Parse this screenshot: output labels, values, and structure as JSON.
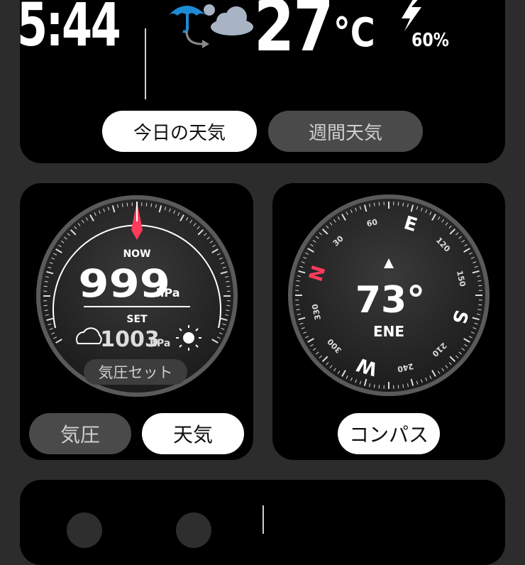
{
  "top": {
    "time": "5:44",
    "temperature": "27",
    "temp_unit": "°C",
    "humidity": "60%",
    "tabs": [
      {
        "label": "今日の天気",
        "active": true
      },
      {
        "label": "週間天気",
        "active": false
      }
    ]
  },
  "barometer": {
    "now_label": "NOW",
    "now_value": "999",
    "now_unit": "hPa",
    "set_label": "SET",
    "set_value": "1003",
    "set_unit": "hPa",
    "set_button": "気圧セット",
    "tabs": [
      {
        "label": "気圧",
        "active": false
      },
      {
        "label": "天気",
        "active": true
      }
    ]
  },
  "compass": {
    "heading": "73°",
    "direction": "ENE",
    "cardinals": {
      "N": "N",
      "E": "E",
      "S": "S",
      "W": "W"
    },
    "degree_marks": [
      "30",
      "60",
      "120",
      "150",
      "210",
      "240",
      "300",
      "330"
    ],
    "button": "コンパス"
  },
  "colors": {
    "accent_red": "#ff3b5c",
    "pill_active_bg": "#ffffff",
    "pill_inactive_bg": "#4a4a4a"
  }
}
